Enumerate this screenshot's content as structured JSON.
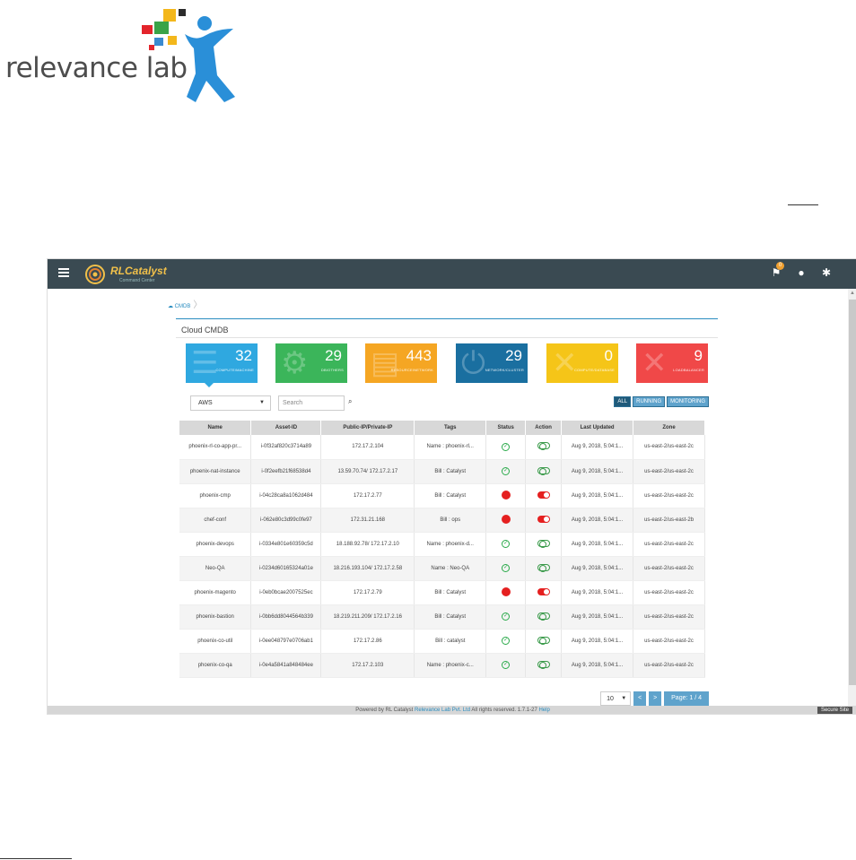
{
  "logo": {
    "text": "relevance lab"
  },
  "app": {
    "brand": {
      "name": "RLCatalyst",
      "tagline": "Command Center"
    },
    "topbar": {
      "notification_count": "0"
    },
    "breadcrumb": {
      "label": "CMDB"
    },
    "panel_title": "Cloud CMDB",
    "tiles": [
      {
        "value": "32",
        "label": "COMPUTE/MACHINE",
        "color": "#2fa8e0",
        "icon": "list-icon"
      },
      {
        "value": "29",
        "label": "DB/OTHERS",
        "color": "#3bb55a",
        "icon": "gear-icon"
      },
      {
        "value": "443",
        "label": "RESOURCE/NETWORK",
        "color": "#f5a623",
        "icon": "database-icon"
      },
      {
        "value": "29",
        "label": "NETWORK/CLUSTER",
        "color": "#1a6fa0",
        "icon": "power-icon"
      },
      {
        "value": "0",
        "label": "COMPUTE/DATABASE",
        "color": "#f5c518",
        "icon": "x-icon"
      },
      {
        "value": "9",
        "label": "LOADBALANCER",
        "color": "#f04848",
        "icon": "x-icon"
      }
    ],
    "filter": {
      "provider": "AWS",
      "search_placeholder": "Search",
      "buttons": [
        "ALL",
        "RUNNING",
        "MONITORING"
      ]
    },
    "table": {
      "headers": [
        "Name",
        "Asset-ID",
        "Public-IP/Private-IP",
        "Tags",
        "Status",
        "Action",
        "Last Updated",
        "Zone"
      ],
      "rows": [
        {
          "name": "phoenix-rl-co-app-pr...",
          "asset": "i-0f32af820c3714a89",
          "ip": "172.17.2.104",
          "tags": "Name : phoenix-rl...",
          "status": "running",
          "last": "Aug 9, 2018, 5:04:1...",
          "zone": "us-east-2/us-east-2c"
        },
        {
          "name": "phoenix-nat-instance",
          "asset": "i-0f2eefb21f68538d4",
          "ip": "13.59.70.74/ 172.17.2.17",
          "tags": "Bill : Catalyst",
          "status": "running",
          "last": "Aug 9, 2018, 5:04:1...",
          "zone": "us-east-2/us-east-2c"
        },
        {
          "name": "phoenix-cmp",
          "asset": "i-04c28ca8a1062d484",
          "ip": "172.17.2.77",
          "tags": "Bill : Catalyst",
          "status": "stopped",
          "last": "Aug 9, 2018, 5:04:1...",
          "zone": "us-east-2/us-east-2c"
        },
        {
          "name": "chef-conf",
          "asset": "i-062e80c3d99c0fe97",
          "ip": "172.31.21.168",
          "tags": "Bill : ops",
          "status": "stopped",
          "last": "Aug 9, 2018, 5:04:1...",
          "zone": "us-east-2/us-east-2b"
        },
        {
          "name": "phoenix-devops",
          "asset": "i-0334e801e60359c5d",
          "ip": "18.188.92.78/ 172.17.2.10",
          "tags": "Name : phoenix-d...",
          "status": "running",
          "last": "Aug 9, 2018, 5:04:1...",
          "zone": "us-east-2/us-east-2c"
        },
        {
          "name": "Neo-QA",
          "asset": "i-0234d60165324a01e",
          "ip": "18.216.193.104/ 172.17.2.58",
          "tags": "Name : Neo-QA",
          "status": "running",
          "last": "Aug 9, 2018, 5:04:1...",
          "zone": "us-east-2/us-east-2c"
        },
        {
          "name": "phoenix-magento",
          "asset": "i-0eb0bcae2007525ec",
          "ip": "172.17.2.79",
          "tags": "Bill : Catalyst",
          "status": "stopped",
          "last": "Aug 9, 2018, 5:04:1...",
          "zone": "us-east-2/us-east-2c"
        },
        {
          "name": "phoenix-bastion",
          "asset": "i-0bb6dd8044564b339",
          "ip": "18.219.211.209/ 172.17.2.16",
          "tags": "Bill : Catalyst",
          "status": "running",
          "last": "Aug 9, 2018, 5:04:1...",
          "zone": "us-east-2/us-east-2c"
        },
        {
          "name": "phoenix-co-util",
          "asset": "i-0ee048797e0706ab1",
          "ip": "172.17.2.86",
          "tags": "Bill : catalyst",
          "status": "running",
          "last": "Aug 9, 2018, 5:04:1...",
          "zone": "us-east-2/us-east-2c"
        },
        {
          "name": "phoenix-co-qa",
          "asset": "i-0e4a5841a848484ee",
          "ip": "172.17.2.103",
          "tags": "Name : phoenix-c...",
          "status": "running",
          "last": "Aug 9, 2018, 5:04:1...",
          "zone": "us-east-2/us-east-2c"
        }
      ]
    },
    "pager": {
      "page_size": "10",
      "prev": "<",
      "next": ">",
      "page_label": "Page: 1 / 4"
    },
    "footer": {
      "text": "Powered by RL Catalyst",
      "company": "Relevance Lab Pvt. Ltd",
      "rights": "All rights reserved. 1.7.1-27",
      "help": "Help",
      "secure": "Secure Site"
    }
  }
}
